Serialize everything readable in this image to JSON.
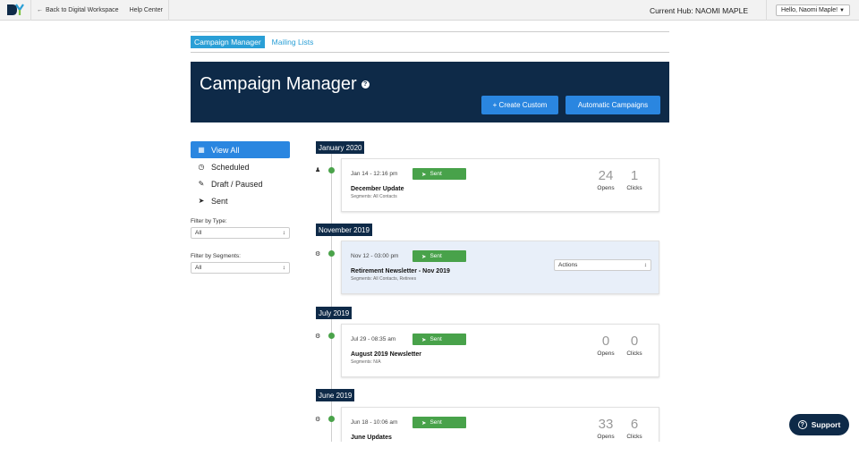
{
  "topbar": {
    "back_label": "Back to Digital Workspace",
    "help_label": "Help Center",
    "hub_label": "Current Hub: NAOMI MAPLE",
    "hello_label": "Hello, Naomi Maple!"
  },
  "tabs": [
    "Campaign Manager",
    "Mailing Lists"
  ],
  "banner": {
    "title": "Campaign Manager",
    "create_label": "+ Create Custom",
    "auto_label": "Automatic Campaigns"
  },
  "sidebar": {
    "items": [
      "View All",
      "Scheduled",
      "Draft / Paused",
      "Sent"
    ],
    "filter_type_label": "Filter by Type:",
    "filter_type_value": "All",
    "filter_segments_label": "Filter by Segments:",
    "filter_segments_value": "All"
  },
  "timeline": {
    "months": [
      "January 2020",
      "November 2019",
      "July 2019",
      "June 2019"
    ],
    "campaigns": [
      {
        "date": "Jan 14 - 12:16 pm",
        "status": "Sent",
        "name": "December Update",
        "segments": "Segments: All Contacts",
        "opens": "24",
        "clicks": "1",
        "opens_label": "Opens",
        "clicks_label": "Clicks"
      },
      {
        "date": "Nov 12 - 03:00 pm",
        "status": "Sent",
        "name": "Retirement Newsletter - Nov 2019",
        "segments": "Segments: All Contacts, Retirees",
        "actions_label": "Actions"
      },
      {
        "date": "Jul 29 - 08:35 am",
        "status": "Sent",
        "name": "August 2019 Newsletter",
        "segments": "Segments: N/A",
        "opens": "0",
        "clicks": "0",
        "opens_label": "Opens",
        "clicks_label": "Clicks"
      },
      {
        "date": "Jun 18 - 10:06 am",
        "status": "Sent",
        "name": "June Updates",
        "opens": "33",
        "clicks": "6",
        "opens_label": "Opens",
        "clicks_label": "Clicks"
      }
    ]
  },
  "support_label": "Support",
  "colors": {
    "navy": "#0e2a48",
    "blue": "#2a86e0",
    "green": "#48a24a",
    "tab_blue": "#2a9fd6"
  }
}
